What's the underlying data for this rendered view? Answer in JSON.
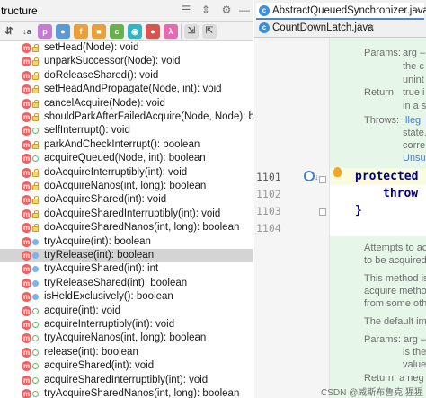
{
  "structure_panel": {
    "title": "tructure",
    "header_icons": [
      "collapse-icon",
      "expand-icon",
      "gear-icon",
      "minimize-icon"
    ],
    "toolbar_icons": [
      "sort-visibility-icon",
      "sort-alpha-icon",
      "show-properties-icon",
      "show-fields-icon",
      "show-inherited-icon",
      "show-anonymous-icon",
      "show-lambdas-icon",
      "show-non-public-icon",
      "autoscroll-to-source-icon",
      "autoscroll-from-source-icon"
    ],
    "items": [
      {
        "label": "setHead(Node): void",
        "visibility": "lock"
      },
      {
        "label": "unparkSuccessor(Node): void",
        "visibility": "lock"
      },
      {
        "label": "doReleaseShared(): void",
        "visibility": "lock"
      },
      {
        "label": "setHeadAndPropagate(Node, int): void",
        "visibility": "lock"
      },
      {
        "label": "cancelAcquire(Node): void",
        "visibility": "lock"
      },
      {
        "label": "shouldParkAfterFailedAcquire(Node, Node): boolean",
        "visibility": "lock"
      },
      {
        "label": "selfInterrupt(): void",
        "visibility": "open"
      },
      {
        "label": "parkAndCheckInterrupt(): boolean",
        "visibility": "lock"
      },
      {
        "label": "acquireQueued(Node, int): boolean",
        "visibility": "open"
      },
      {
        "label": "doAcquireInterruptibly(int): void",
        "visibility": "lock"
      },
      {
        "label": "doAcquireNanos(int, long): boolean",
        "visibility": "lock"
      },
      {
        "label": "doAcquireShared(int): void",
        "visibility": "lock"
      },
      {
        "label": "doAcquireSharedInterruptibly(int): void",
        "visibility": "lock"
      },
      {
        "label": "doAcquireSharedNanos(int, long): boolean",
        "visibility": "lock"
      },
      {
        "label": "tryAcquire(int): boolean",
        "visibility": "key"
      },
      {
        "label": "tryRelease(int): boolean",
        "visibility": "key",
        "selected": true
      },
      {
        "label": "tryAcquireShared(int): int",
        "visibility": "key"
      },
      {
        "label": "tryReleaseShared(int): boolean",
        "visibility": "key"
      },
      {
        "label": "isHeldExclusively(): boolean",
        "visibility": "key"
      },
      {
        "label": "acquire(int): void",
        "visibility": "open"
      },
      {
        "label": "acquireInterruptibly(int): void",
        "visibility": "open"
      },
      {
        "label": "tryAcquireNanos(int, long): boolean",
        "visibility": "open"
      },
      {
        "label": "release(int): boolean",
        "visibility": "open"
      },
      {
        "label": "acquireShared(int): void",
        "visibility": "open"
      },
      {
        "label": "acquireSharedInterruptibly(int): void",
        "visibility": "open"
      },
      {
        "label": "tryAcquireSharedNanos(int, long): boolean",
        "visibility": "open"
      }
    ]
  },
  "editor": {
    "tabs": [
      {
        "label": "AbstractQueuedSynchronizer.java",
        "active": true
      },
      {
        "label": "CountDownLatch.java",
        "active": false
      }
    ],
    "line_numbers": [
      "1101",
      "1102",
      "1103",
      "1104"
    ],
    "code_lines": [
      "protected b",
      "throw n",
      "}"
    ],
    "doc_top": {
      "params_key": "Params:",
      "params_lines": [
        "arg –",
        "the c",
        "unint"
      ],
      "returns_key": "Return:",
      "returns_lines": [
        "true i",
        "in a st"
      ],
      "throws_key": "Throws:",
      "throws_lines": [
        "Illeg",
        "state.",
        "corre",
        "Unsup"
      ]
    },
    "doc_bottom": {
      "lines": [
        "Attempts to ac",
        "to be acquired",
        "This method is",
        "acquire metho",
        "from some oth",
        "The default im",
        "Params: arg –",
        "is the",
        "value",
        "Return: a neg"
      ]
    }
  },
  "watermark": "CSDN @威斯布鲁克.猩猩"
}
